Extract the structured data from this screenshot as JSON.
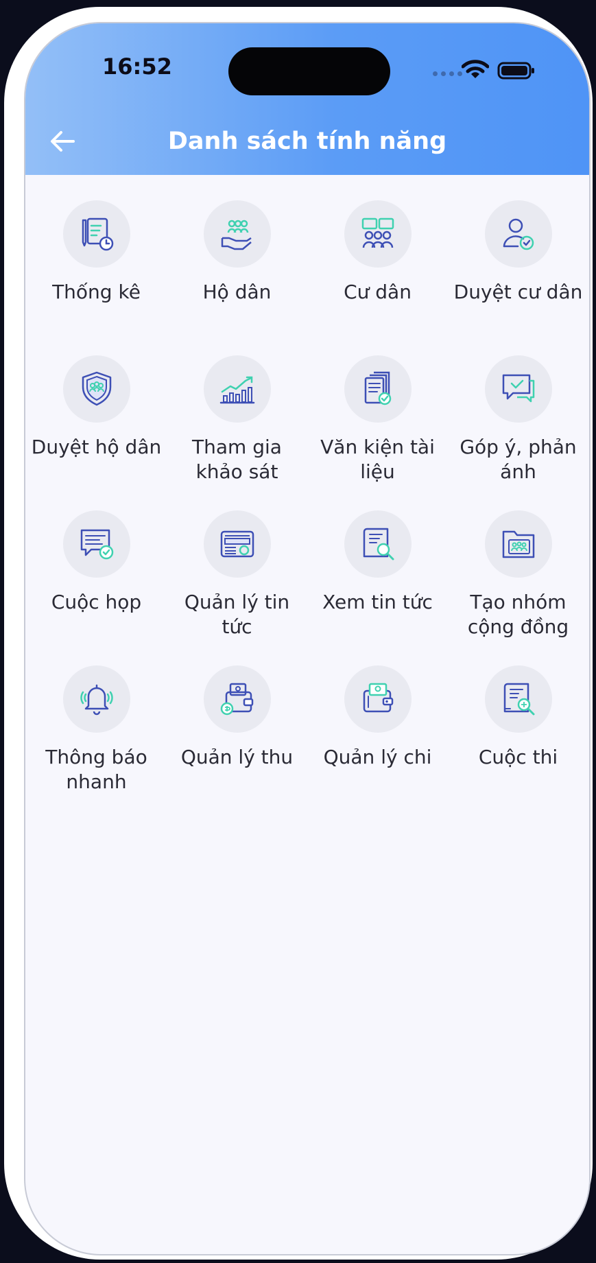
{
  "status_bar": {
    "time": "16:52"
  },
  "header": {
    "title": "Danh sách tính năng"
  },
  "features": [
    {
      "label": "Thống kê",
      "icon": "statistics-icon"
    },
    {
      "label": "Hộ dân",
      "icon": "households-icon"
    },
    {
      "label": "Cư dân",
      "icon": "residents-icon"
    },
    {
      "label": "Duyệt cư dân",
      "icon": "approve-resident-icon"
    },
    {
      "label": "Duyệt hộ dân",
      "icon": "approve-household-icon"
    },
    {
      "label": "Tham gia khảo sát",
      "icon": "survey-chart-icon"
    },
    {
      "label": "Văn kiện tài liệu",
      "icon": "documents-icon"
    },
    {
      "label": "Góp ý, phản ánh",
      "icon": "feedback-icon"
    },
    {
      "label": "Cuộc họp",
      "icon": "meeting-icon"
    },
    {
      "label": "Quản lý tin tức",
      "icon": "radio-news-icon"
    },
    {
      "label": "Xem tin tức",
      "icon": "view-news-icon"
    },
    {
      "label": "Tạo nhóm cộng đồng",
      "icon": "community-group-icon"
    },
    {
      "label": "Thông báo nhanh",
      "icon": "bell-icon"
    },
    {
      "label": "Quản lý thu",
      "icon": "income-wallet-icon"
    },
    {
      "label": "Quản lý chi",
      "icon": "expense-wallet-icon"
    },
    {
      "label": "Cuộc thi",
      "icon": "contest-icon"
    }
  ],
  "colors": {
    "header_start": "#93bff7",
    "header_end": "#4f94f6",
    "icon_blue": "#3d4fb5",
    "icon_teal": "#3fd1b0",
    "circle_bg": "#e9eaf1"
  }
}
